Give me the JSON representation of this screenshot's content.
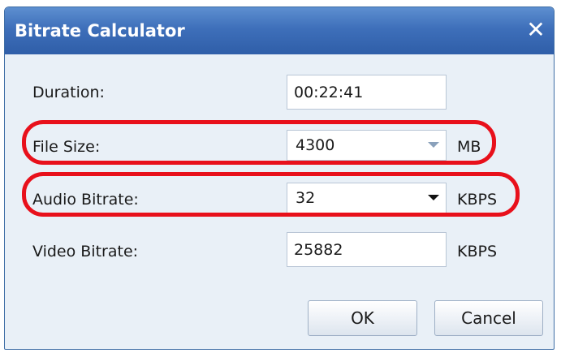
{
  "window": {
    "title": "Bitrate Calculator",
    "close_icon": "close-icon"
  },
  "fields": {
    "duration": {
      "label": "Duration:",
      "value": "00:22:41"
    },
    "file_size": {
      "label": "File Size:",
      "value": "4300",
      "unit": "MB"
    },
    "audio_bitrate": {
      "label": "Audio Bitrate:",
      "value": "32",
      "unit": "KBPS"
    },
    "video_bitrate": {
      "label": "Video Bitrate:",
      "value": "25882",
      "unit": "KBPS"
    }
  },
  "buttons": {
    "ok": "OK",
    "cancel": "Cancel"
  },
  "colors": {
    "titlebar": "#3e6fba",
    "highlight": "#e8101b",
    "dialog_bg": "#e9f0f7"
  }
}
